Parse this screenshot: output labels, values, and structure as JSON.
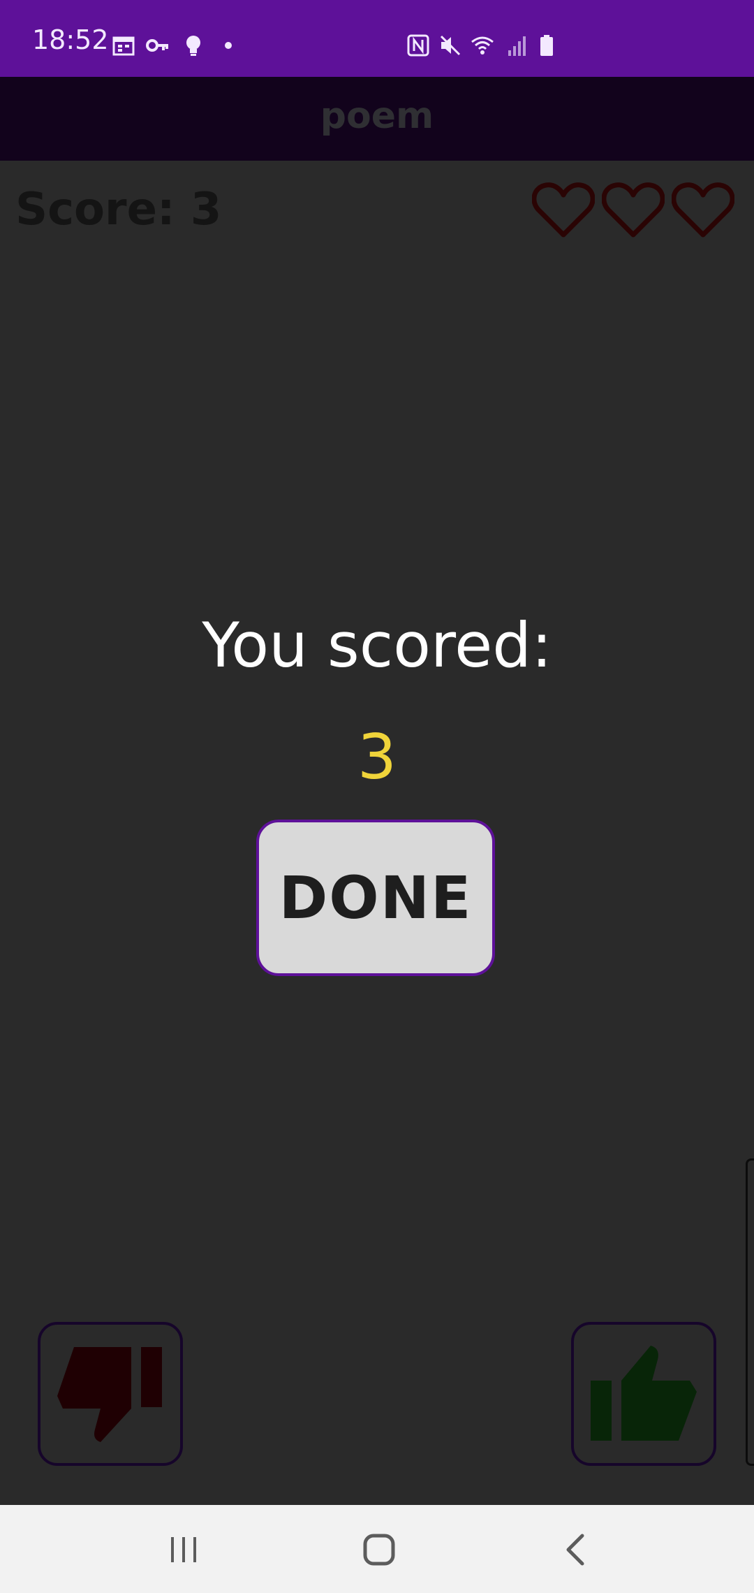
{
  "status_bar": {
    "time": "18:52",
    "icons": [
      "calendar-icon",
      "key-icon",
      "bulb-icon",
      "dot-icon",
      "nfc-icon",
      "mute-icon",
      "wifi-icon",
      "signal-icon",
      "battery-icon"
    ]
  },
  "app_bar": {
    "title": "poem"
  },
  "game": {
    "score_label": "Score: 3",
    "lives": 3,
    "result_label": "You scored:",
    "result_value": "3",
    "done_label": "DONE"
  },
  "controls": {
    "dislike_icon": "thumbs-down-icon",
    "like_icon": "thumbs-up-icon"
  },
  "nav_bar": {
    "icons": [
      "recents-icon",
      "home-icon",
      "back-icon"
    ]
  },
  "colors": {
    "status_bar": "#5e1199",
    "app_bar": "#12031c",
    "background": "#2a2a2a",
    "accent": "#5e1199",
    "result_value": "#f0d43a",
    "heart_outline": "#2a0404",
    "dislike": "#1f0003",
    "like": "#082508"
  }
}
